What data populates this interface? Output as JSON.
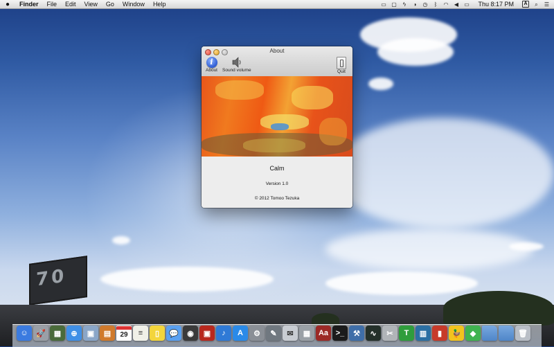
{
  "menubar": {
    "app_name": "Finder",
    "menus": [
      "File",
      "Edit",
      "View",
      "Go",
      "Window",
      "Help"
    ],
    "clock": "Thu 8:17 PM",
    "input_menu_letter": "A"
  },
  "window": {
    "title": "About",
    "toolbar": {
      "about_label": "About",
      "sound_label": "Sound volume",
      "quit_label": "Quit"
    },
    "app_name": "Calm",
    "version": "Version 1.0",
    "copyright": "© 2012 Tomoo Tezuka"
  },
  "billboard_text": "70",
  "dock": {
    "calendar_day": "29",
    "items": [
      {
        "name": "finder-icon",
        "glyph": "☺",
        "color": "#3b7be0"
      },
      {
        "name": "launchpad-icon",
        "glyph": "🚀",
        "color": "#9a9fa6"
      },
      {
        "name": "mission-control-icon",
        "glyph": "▦",
        "color": "#4a6b3a"
      },
      {
        "name": "safari-icon",
        "glyph": "⊕",
        "color": "#3f8fe6"
      },
      {
        "name": "preview-icon",
        "glyph": "▣",
        "color": "#8aa6c8"
      },
      {
        "name": "ibooks-icon",
        "glyph": "▤",
        "color": "#d07a2c"
      },
      {
        "name": "calendar-icon",
        "glyph": "",
        "color": "#ffffff"
      },
      {
        "name": "notes-icon",
        "glyph": "≡",
        "color": "#f0f0e8"
      },
      {
        "name": "stickies-icon",
        "glyph": "▯",
        "color": "#f3d53c"
      },
      {
        "name": "messages-icon",
        "glyph": "💬",
        "color": "#5aa0f0"
      },
      {
        "name": "facetime-icon",
        "glyph": "◉",
        "color": "#3a3a3a"
      },
      {
        "name": "photo-booth-icon",
        "glyph": "▣",
        "color": "#b8281e"
      },
      {
        "name": "itunes-icon",
        "glyph": "♪",
        "color": "#2f7ad6"
      },
      {
        "name": "app-store-icon",
        "glyph": "A",
        "color": "#2a8ae8"
      },
      {
        "name": "system-preferences-icon",
        "glyph": "⚙",
        "color": "#8a8f96"
      },
      {
        "name": "utilities-icon",
        "glyph": "✎",
        "color": "#707880"
      },
      {
        "name": "mail-icon",
        "glyph": "✉",
        "color": "#c8ccd2"
      },
      {
        "name": "calculator-icon",
        "glyph": "▦",
        "color": "#9aa0a6"
      },
      {
        "name": "dictionary-icon",
        "glyph": "Aa",
        "color": "#9c2a26"
      },
      {
        "name": "terminal-icon",
        "glyph": ">_",
        "color": "#1b1b1b"
      },
      {
        "name": "xcode-icon",
        "glyph": "⚒",
        "color": "#3f6ea8"
      },
      {
        "name": "activity-monitor-icon",
        "glyph": "∿",
        "color": "#24302a"
      },
      {
        "name": "script-editor-icon",
        "glyph": "✂",
        "color": "#b0b4b8"
      },
      {
        "name": "textwrangler-icon",
        "glyph": "T",
        "color": "#2f9d3c"
      },
      {
        "name": "photo-app-icon",
        "glyph": "▥",
        "color": "#2b6fa3"
      },
      {
        "name": "books-icon",
        "glyph": "▮",
        "color": "#c73a2a"
      },
      {
        "name": "cyberduck-icon",
        "glyph": "🦆",
        "color": "#f2c31e"
      },
      {
        "name": "green-cube-icon",
        "glyph": "◆",
        "color": "#3fb34f"
      },
      {
        "name": "applications-folder-icon",
        "glyph": "",
        "color": "#78a8e0"
      },
      {
        "name": "documents-folder-icon",
        "glyph": "",
        "color": "#78a8e0"
      },
      {
        "name": "trash-icon",
        "glyph": "🗑",
        "color": "#b9bec6"
      }
    ]
  }
}
